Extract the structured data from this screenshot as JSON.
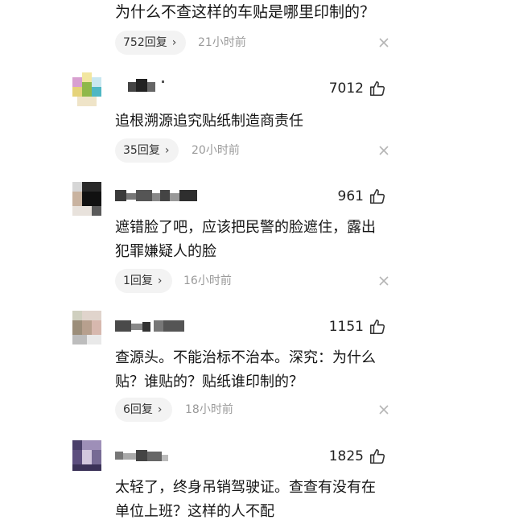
{
  "top_comment": {
    "text_tail": "为什么不查这样的车贴是哪里印制的？",
    "replies": "752回复",
    "time": "21小时前"
  },
  "comments": [
    {
      "likes": "7012",
      "text": "追根溯源追究贴纸制造商责任",
      "replies": "35回复",
      "time": "20小时前"
    },
    {
      "likes": "961",
      "text": "遮错脸了吧，应该把民警的脸遮住，露出犯罪嫌疑人的脸",
      "replies": "1回复",
      "time": "16小时前"
    },
    {
      "likes": "1151",
      "text": "查源头。不能治标不治本。深究：为什么贴？谁贴的？贴纸谁印制的？",
      "replies": "6回复",
      "time": "18小时前"
    },
    {
      "likes": "1825",
      "text": "太轻了，终身吊销驾驶证。查查有没有在单位上班？这样的人不配"
    }
  ],
  "icons": {
    "like": "thumbs-up-icon",
    "close": "close-icon",
    "chevron": "chevron-right-icon"
  },
  "colors": {
    "text": "#151515",
    "meta": "#9a9a9a",
    "pill_bg": "#f3f3f3"
  }
}
